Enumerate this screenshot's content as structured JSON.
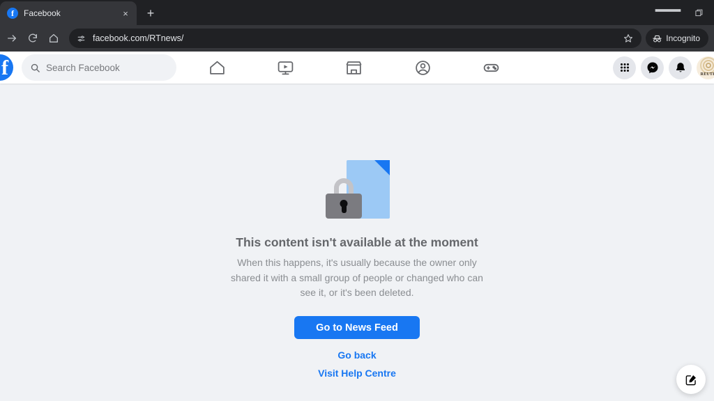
{
  "browser": {
    "tab": {
      "title": "Facebook",
      "favicon": "facebook-favicon",
      "close_label": "×"
    },
    "new_tab_label": "+",
    "window_controls": {
      "minimize": "—",
      "maximize": "maximize-icon"
    },
    "toolbar": {
      "forward_icon": "forward-arrow-icon",
      "reload_icon": "reload-icon",
      "home_icon": "home-icon",
      "site_info_icon": "site-settings-icon",
      "url": "facebook.com/RTnews/",
      "bookmark_icon": "star-icon",
      "incognito_label": "Incognito",
      "incognito_icon": "incognito-hat-icon"
    }
  },
  "fbnav": {
    "logo": "f",
    "search": {
      "placeholder": "Search Facebook",
      "icon": "search-icon"
    },
    "tabs": [
      {
        "name": "home",
        "icon": "home-icon"
      },
      {
        "name": "video",
        "icon": "video-play-icon"
      },
      {
        "name": "marketplace",
        "icon": "storefront-icon"
      },
      {
        "name": "groups",
        "icon": "groups-icon"
      },
      {
        "name": "gaming",
        "icon": "gamepad-icon"
      }
    ],
    "actions": [
      {
        "name": "menu",
        "icon": "grid-menu-icon"
      },
      {
        "name": "messenger",
        "icon": "messenger-icon"
      },
      {
        "name": "notifications",
        "icon": "bell-icon"
      }
    ],
    "avatar": {
      "name": "profile-avatar",
      "text": "REUTE"
    }
  },
  "main": {
    "illustration": "locked-document-icon",
    "headline": "This content isn't available at the moment",
    "subtext": "When this happens, it's usually because the owner only shared it with a small group of people or changed who can see it, or it's been deleted.",
    "primary_button": "Go to News Feed",
    "links": [
      {
        "name": "go-back",
        "label": "Go back"
      },
      {
        "name": "visit-help-centre",
        "label": "Visit Help Centre"
      }
    ],
    "fab_icon": "compose-icon"
  },
  "colors": {
    "fb_blue": "#1877f2",
    "page_bg": "#f0f2f5",
    "nav_bg": "#ffffff",
    "chrome_dark": "#35363a",
    "tabstrip_dark": "#202124",
    "text_muted": "#65676b"
  }
}
